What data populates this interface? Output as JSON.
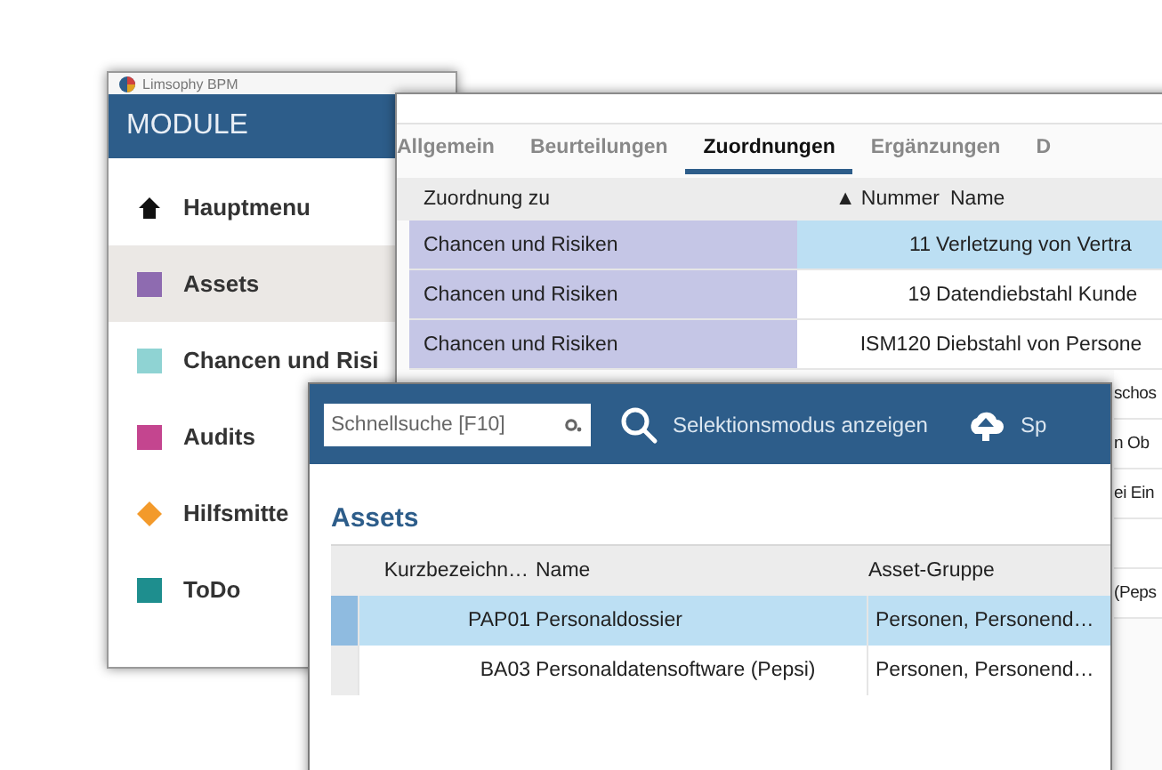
{
  "module_window": {
    "title": "Limsophy BPM",
    "header": "MODULE",
    "items": [
      {
        "label": "Hauptmenu",
        "kind": "home",
        "color": "#111111",
        "selected": false
      },
      {
        "label": "Assets",
        "kind": "square",
        "color": "#8e6bb0",
        "selected": true
      },
      {
        "label": "Chancen und Risi",
        "kind": "square",
        "color": "#8fd3d3",
        "selected": false
      },
      {
        "label": "Audits",
        "kind": "square",
        "color": "#c4458f",
        "selected": false
      },
      {
        "label": "Hilfsmitte",
        "kind": "diamond",
        "color": "#f39a2b",
        "selected": false
      },
      {
        "label": "ToDo",
        "kind": "square",
        "color": "#1e8e8e",
        "selected": false
      }
    ]
  },
  "detail_window": {
    "tabs": [
      {
        "label": "Allgemein",
        "selected": false
      },
      {
        "label": "Beurteilungen",
        "selected": false
      },
      {
        "label": "Zuordnungen",
        "selected": true
      },
      {
        "label": "Ergänzungen",
        "selected": false
      },
      {
        "label": "D",
        "selected": false
      }
    ],
    "table": {
      "columns": [
        "Zuordnung zu",
        "▲ Nummer",
        "Name"
      ],
      "rows": [
        {
          "kind": "full",
          "zuordnung": "Chancen und Risiken",
          "nummer": "11",
          "name": "Verletzung von Vertra",
          "selected": true
        },
        {
          "kind": "full",
          "zuordnung": "Chancen und Risiken",
          "nummer": "19",
          "name": "Datendiebstahl Kunde",
          "selected": false
        },
        {
          "kind": "full",
          "zuordnung": "Chancen und Risiken",
          "nummer": "ISM120",
          "name": "Diebstahl von Persone",
          "selected": false
        },
        {
          "kind": "fragment",
          "name": "schos",
          "selected": false
        },
        {
          "kind": "fragment",
          "name": "n Ob",
          "selected": false
        },
        {
          "kind": "fragment",
          "name": "ei Ein",
          "selected": false
        },
        {
          "kind": "fragment",
          "name": "(Peps",
          "selected": false
        }
      ]
    }
  },
  "assets_window": {
    "toolbar": {
      "search": {
        "placeholder": "Schnellsuche [F10]"
      },
      "buttons": [
        {
          "kind": "search",
          "label": "Selektionsmodus anzeigen"
        },
        {
          "kind": "upload",
          "label": "Sp"
        }
      ]
    },
    "heading": "Assets",
    "table": {
      "columns": [
        "Kurzbezeichn…",
        "Name",
        "Asset-Gruppe"
      ],
      "rows": [
        {
          "kurz": "PAP01",
          "name": "Personaldossier",
          "gruppe": "Personen, Personend…",
          "selected": true
        },
        {
          "kurz": "BA03",
          "name": "Personaldatensoftware (Pepsi)",
          "gruppe": "Personen, Personend…",
          "selected": false
        }
      ]
    }
  }
}
